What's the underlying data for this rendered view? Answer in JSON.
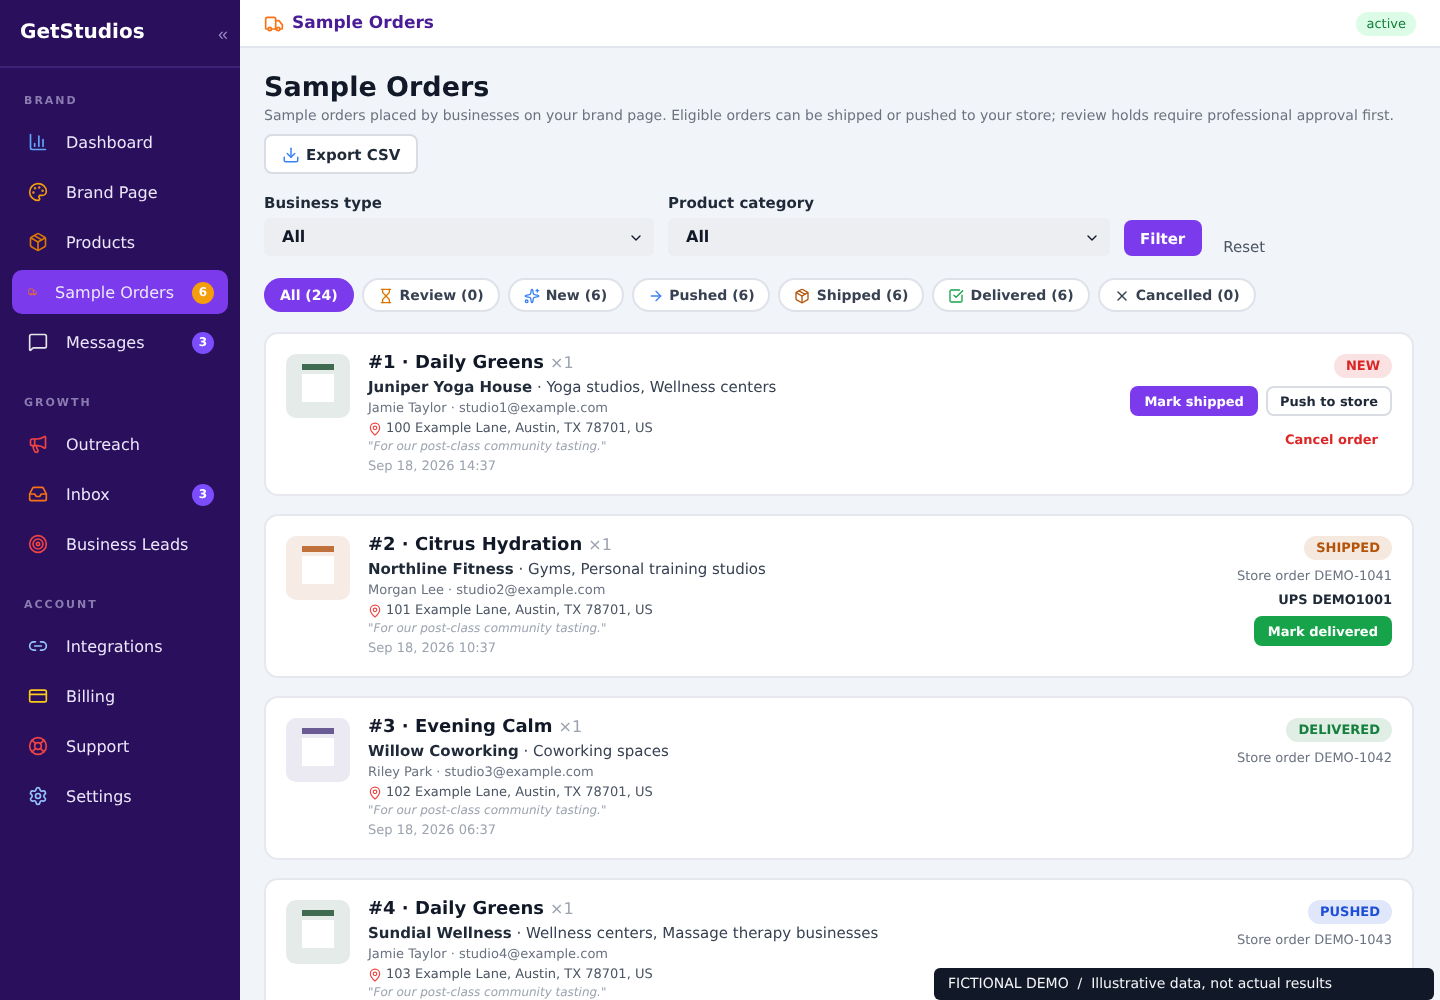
{
  "sidebar": {
    "brand": "GetStudios",
    "collapse": "«",
    "sections": [
      {
        "title": "BRAND",
        "items": [
          {
            "label": "Dashboard",
            "selected": false
          },
          {
            "label": "Brand Page",
            "selected": false
          },
          {
            "label": "Products",
            "selected": false
          },
          {
            "label": "Sample Orders",
            "selected": true,
            "badge": "6"
          },
          {
            "label": "Messages",
            "selected": false,
            "badge": "3"
          }
        ]
      },
      {
        "title": "GROWTH",
        "items": [
          {
            "label": "Outreach",
            "selected": false
          },
          {
            "label": "Inbox",
            "selected": false,
            "badge": "3"
          },
          {
            "label": "Business Leads",
            "selected": false
          }
        ]
      },
      {
        "title": "ACCOUNT",
        "items": [
          {
            "label": "Integrations",
            "selected": false
          },
          {
            "label": "Billing",
            "selected": false
          },
          {
            "label": "Support",
            "selected": false
          },
          {
            "label": "Settings",
            "selected": false
          }
        ]
      }
    ]
  },
  "header": {
    "title": "Sample Orders",
    "status": "active"
  },
  "page": {
    "title": "Sample Orders",
    "description": "Sample orders placed by businesses on your brand page. Eligible orders can be shipped or pushed to your store; review holds require professional approval first.",
    "export_button": "Export CSV",
    "filters": [
      {
        "label": "Business type",
        "value": "All"
      },
      {
        "label": "Product category",
        "value": "All"
      }
    ],
    "filter_button": "Filter",
    "reset_link": "Reset",
    "tabs": [
      {
        "label": "All (24)",
        "selected": true
      },
      {
        "label": "Review (0)",
        "selected": false
      },
      {
        "label": "New (6)",
        "selected": false
      },
      {
        "label": "Pushed (6)",
        "selected": false
      },
      {
        "label": "Shipped (6)",
        "selected": false
      },
      {
        "label": "Delivered (6)",
        "selected": false
      },
      {
        "label": "Cancelled (0)",
        "selected": false
      }
    ]
  },
  "orders": [
    {
      "title": "#1 · Daily Greens",
      "quantity": "×1",
      "business": "**Juniper Yoga House** · Yoga studios, Wellness centers",
      "contact": "Jamie Taylor · studio1@example.com",
      "address": "100 Example Lane, Austin, TX 78701, US",
      "note": "\"For our post-class community tasting.\"",
      "date": "Sep 18, 2026 14:37",
      "thumbnail": {
        "color": "#3f6b50"
      },
      "status": {
        "label": "NEW",
        "color": "#dc2626"
      },
      "actions": [
        {
          "label": "Mark shipped",
          "kind": "primary"
        },
        {
          "label": "Push to store",
          "kind": "outline"
        },
        {
          "label": "Cancel order",
          "kind": "danger"
        }
      ]
    },
    {
      "title": "#2 · Citrus Hydration",
      "quantity": "×1",
      "business": "**Northline Fitness** · Gyms, Personal training studios",
      "contact": "Morgan Lee · studio2@example.com",
      "address": "101 Example Lane, Austin, TX 78701, US",
      "note": "\"For our post-class community tasting.\"",
      "date": "Sep 18, 2026 10:37",
      "thumbnail": {
        "color": "#c0703a"
      },
      "status": {
        "label": "SHIPPED",
        "color": "#b45309"
      },
      "store_order": "Store order DEMO-1041",
      "tracking": "UPS DEMO1001",
      "actions": [
        {
          "label": "Mark delivered",
          "kind": "success"
        }
      ]
    },
    {
      "title": "#3 · Evening Calm",
      "quantity": "×1",
      "business": "**Willow Coworking** · Coworking spaces",
      "contact": "Riley Park · studio3@example.com",
      "address": "102 Example Lane, Austin, TX 78701, US",
      "note": "\"For our post-class community tasting.\"",
      "date": "Sep 18, 2026 06:37",
      "thumbnail": {
        "color": "#6b5b95"
      },
      "status": {
        "label": "DELIVERED",
        "color": "#15803d"
      },
      "store_order": "Store order DEMO-1042"
    },
    {
      "title": "#4 · Daily Greens",
      "quantity": "×1",
      "business": "**Sundial Wellness** · Wellness centers, Massage therapy businesses",
      "contact": "Jamie Taylor · studio4@example.com",
      "address": "103 Example Lane, Austin, TX 78701, US",
      "note": "\"For our post-class community tasting.\"",
      "thumbnail": {
        "color": "#3f6b50"
      },
      "status": {
        "label": "PUSHED",
        "color": "#1d4ed8"
      },
      "store_order": "Store order DEMO-1043"
    }
  ],
  "banner": "FICTIONAL DEMO  /  Illustrative data, not actual results"
}
